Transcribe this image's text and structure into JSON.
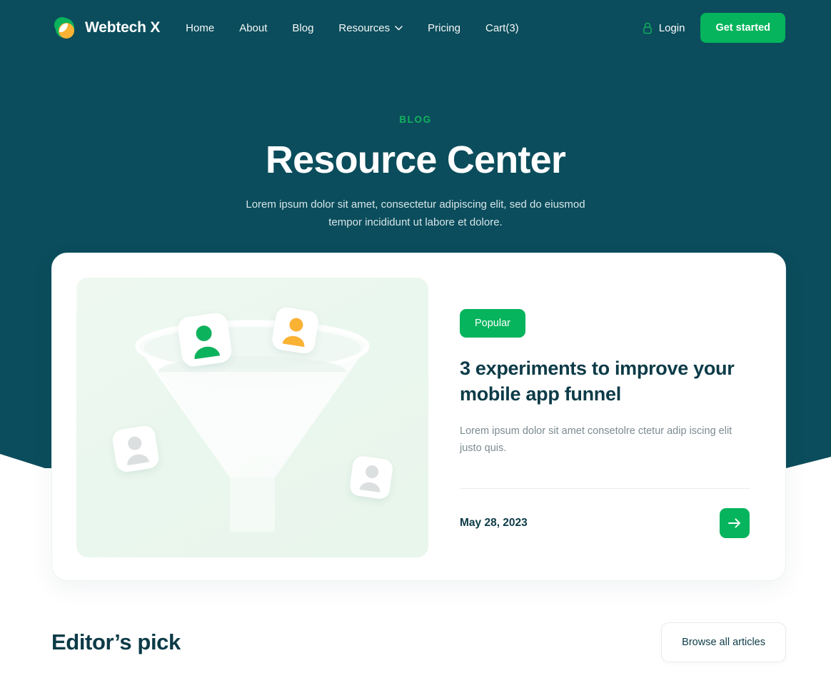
{
  "theme": {
    "teal": "#0b4d5c",
    "green": "#05b45c",
    "green_accent": "#12b25d",
    "dark_text": "#0c3b47",
    "muted_text": "#7b8b90",
    "orange": "#f9b233"
  },
  "header": {
    "brand": "Webtech X",
    "logo_icon": "leaf-logo-icon",
    "nav": [
      {
        "label": "Home",
        "icon": null
      },
      {
        "label": "About",
        "icon": null
      },
      {
        "label": "Blog",
        "icon": null
      },
      {
        "label": "Resources",
        "icon": "chevron-down-icon"
      },
      {
        "label": "Pricing",
        "icon": null
      },
      {
        "label": "Cart(3)",
        "icon": null
      }
    ],
    "login_label": "Login",
    "login_icon": "lock-icon",
    "cta_label": "Get started"
  },
  "hero": {
    "eyebrow": "BLOG",
    "title": "Resource Center",
    "subtitle": "Lorem ipsum dolor sit amet, consectetur adipiscing elit, sed do eiusmod tempor incididunt ut labore et dolore."
  },
  "feature_card": {
    "image_alt": "funnel-illustration",
    "badge": "Popular",
    "title": "3 experiments to improve your mobile app funnel",
    "description": "Lorem ipsum dolor sit amet consetolre ctetur adip iscing elit justo quis.",
    "date": "May 28, 2023",
    "arrow_icon": "arrow-right-icon"
  },
  "editors_pick": {
    "title": "Editor’s pick",
    "browse_label": "Browse all articles"
  }
}
